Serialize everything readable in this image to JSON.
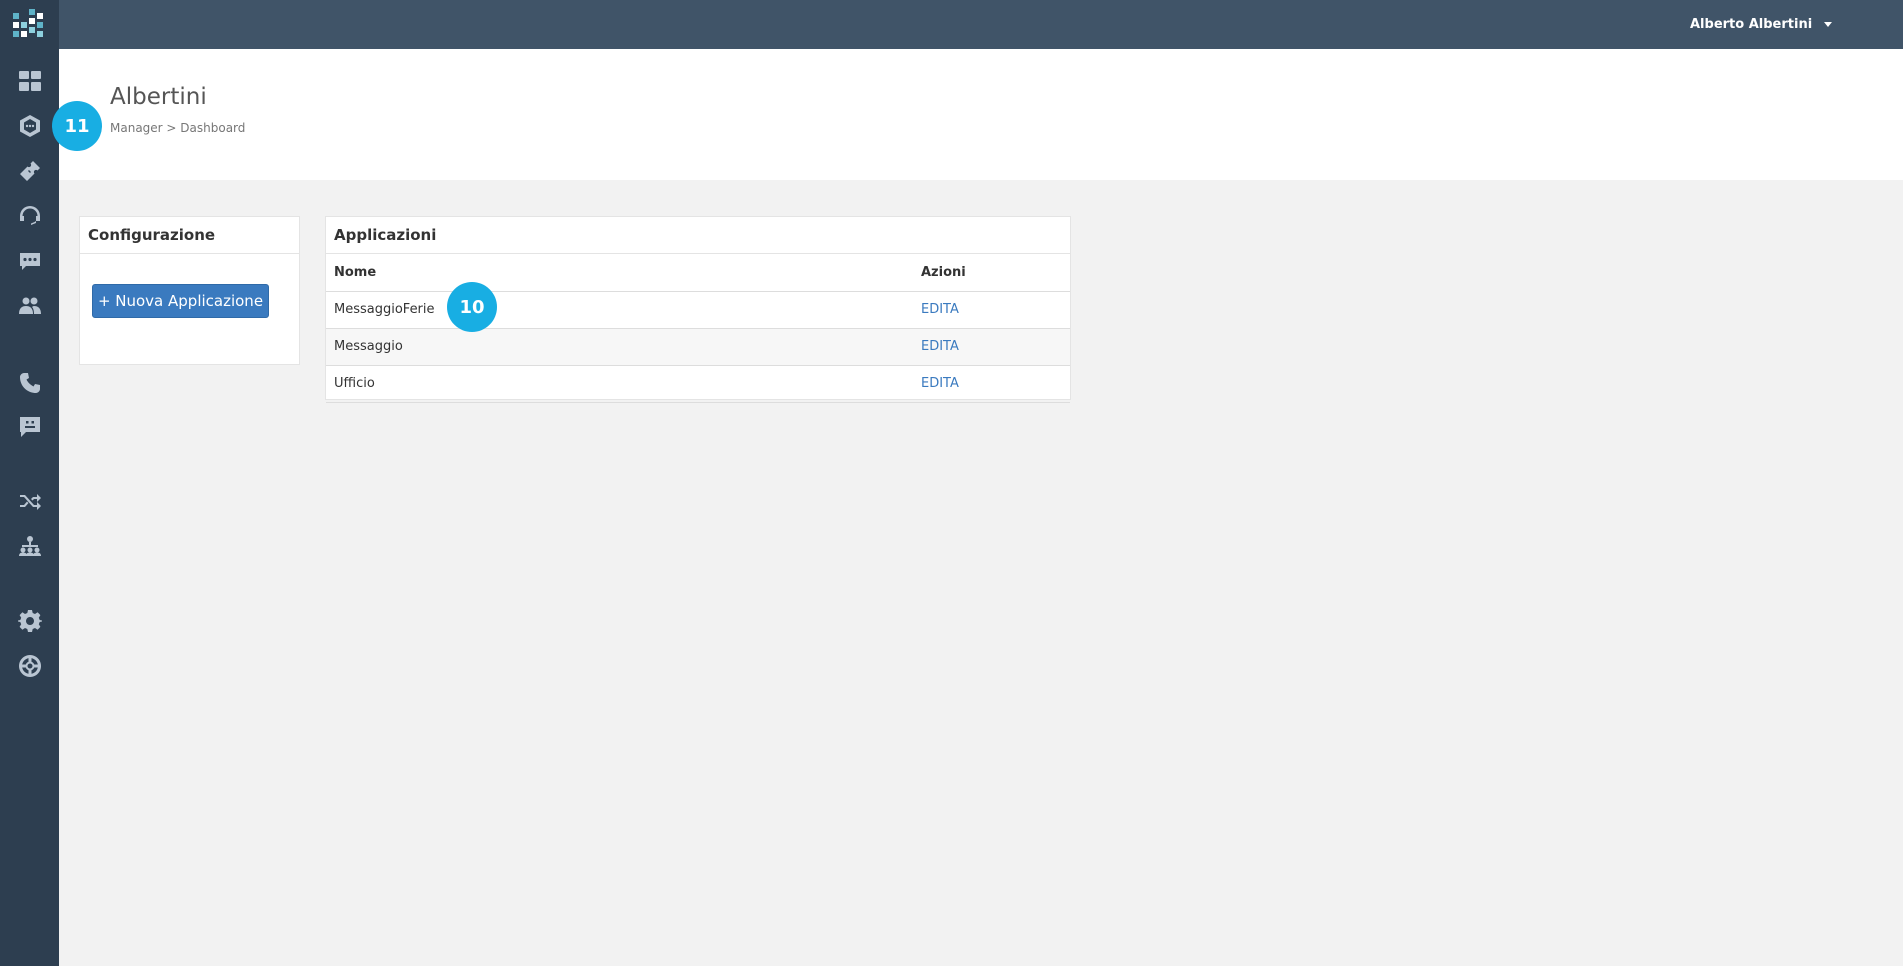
{
  "user": {
    "name": "Alberto Albertini"
  },
  "header": {
    "title": "Albertini",
    "breadcrumb": "Manager > Dashboard"
  },
  "badges": {
    "header_badge": "11",
    "table_badge": "10"
  },
  "sidebar": {
    "items": [
      {
        "icon": "dashboard-icon"
      },
      {
        "icon": "hexagon-chat-icon"
      },
      {
        "icon": "ticket-icon"
      },
      {
        "icon": "headset-icon"
      },
      {
        "icon": "message-dots-icon"
      },
      {
        "icon": "users-icon"
      },
      {
        "icon": "phone-icon"
      },
      {
        "icon": "sms-icon"
      },
      {
        "icon": "shuffle-icon"
      },
      {
        "icon": "org-chart-icon"
      },
      {
        "icon": "gear-icon"
      },
      {
        "icon": "lifebuoy-icon"
      }
    ]
  },
  "config_panel": {
    "title": "Configurazione",
    "new_button_label": "+ Nuova Applicazione"
  },
  "apps_panel": {
    "title": "Applicazioni",
    "columns": {
      "name": "Nome",
      "actions": "Azioni"
    },
    "rows": [
      {
        "name": "MessaggioFerie",
        "action": "EDITA"
      },
      {
        "name": "Messaggio",
        "action": "EDITA"
      },
      {
        "name": "Ufficio",
        "action": "EDITA"
      }
    ]
  },
  "colors": {
    "topbar": "#405468",
    "sidebar": "#2d3e50",
    "accent": "#3a7abf",
    "badge": "#18aee3"
  }
}
